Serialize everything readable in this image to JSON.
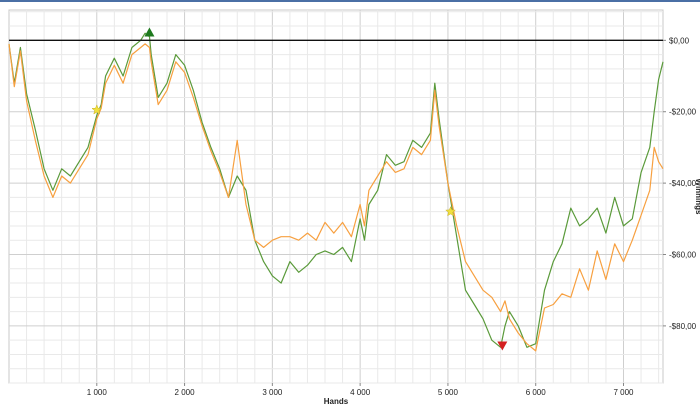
{
  "chart_data": {
    "type": "line",
    "title": "",
    "xlabel": "Hands",
    "ylabel": "Winnings",
    "xlim": [
      0,
      7450
    ],
    "ylim": [
      -96,
      8.5
    ],
    "x_ticks": [
      {
        "value": 1000,
        "label": "1 000"
      },
      {
        "value": 2000,
        "label": "2 000"
      },
      {
        "value": 3000,
        "label": "3 000"
      },
      {
        "value": 4000,
        "label": "4 000"
      },
      {
        "value": 5000,
        "label": "5 000"
      },
      {
        "value": 6000,
        "label": "6 000"
      },
      {
        "value": 7000,
        "label": "7 000"
      }
    ],
    "y_ticks": [
      {
        "value": 0,
        "label": "$0,00"
      },
      {
        "value": -20,
        "label": "-$20,00"
      },
      {
        "value": -40,
        "label": "-$40,00"
      },
      {
        "value": -60,
        "label": "-$60,00"
      },
      {
        "value": -80,
        "label": "-$80,00"
      }
    ],
    "grid": true,
    "legend": "none",
    "zero_line": 0,
    "series": [
      {
        "color": "#5a9a3a",
        "x": [
          0,
          60,
          130,
          200,
          300,
          400,
          500,
          600,
          700,
          800,
          900,
          1000,
          1050,
          1100,
          1200,
          1300,
          1400,
          1500,
          1550,
          1600,
          1620,
          1700,
          1800,
          1900,
          2000,
          2100,
          2200,
          2300,
          2400,
          2500,
          2600,
          2700,
          2800,
          2900,
          3000,
          3100,
          3200,
          3300,
          3400,
          3500,
          3600,
          3700,
          3800,
          3900,
          4000,
          4050,
          4100,
          4200,
          4300,
          4400,
          4500,
          4600,
          4700,
          4800,
          4850,
          4900,
          5000,
          5100,
          5200,
          5300,
          5400,
          5500,
          5600,
          5650,
          5700,
          5800,
          5900,
          6000,
          6100,
          6200,
          6300,
          6400,
          6500,
          6600,
          6700,
          6800,
          6900,
          7000,
          7100,
          7200,
          7300,
          7350,
          7400,
          7450
        ],
        "y": [
          -1,
          -12,
          -2,
          -15,
          -25,
          -36,
          -42,
          -36,
          -38,
          -34,
          -30,
          -21,
          -18,
          -10,
          -5,
          -10,
          -2,
          0,
          2,
          1,
          -4,
          -16,
          -12,
          -4,
          -7,
          -14,
          -23,
          -30,
          -36,
          -44,
          -38,
          -42,
          -56,
          -62,
          -66,
          -68,
          -62,
          -65,
          -63,
          -60,
          -59,
          -60,
          -58,
          -62,
          -50,
          -56,
          -46,
          -42,
          -32,
          -35,
          -34,
          -28,
          -30,
          -26,
          -12,
          -22,
          -40,
          -55,
          -70,
          -74,
          -78,
          -84,
          -86,
          -80,
          -76,
          -80,
          -86,
          -85,
          -70,
          -62,
          -57,
          -47,
          -52,
          -50,
          -47,
          -54,
          -44,
          -52,
          -50,
          -37,
          -30,
          -20,
          -11,
          -6
        ]
      },
      {
        "color": "#f7a040",
        "x": [
          0,
          60,
          130,
          200,
          300,
          400,
          500,
          600,
          700,
          800,
          900,
          1000,
          1050,
          1100,
          1200,
          1300,
          1400,
          1500,
          1550,
          1600,
          1620,
          1700,
          1800,
          1900,
          2000,
          2100,
          2200,
          2300,
          2400,
          2500,
          2600,
          2700,
          2800,
          2900,
          3000,
          3100,
          3200,
          3300,
          3400,
          3500,
          3600,
          3700,
          3800,
          3900,
          4000,
          4050,
          4100,
          4200,
          4300,
          4400,
          4500,
          4600,
          4700,
          4800,
          4850,
          4900,
          5000,
          5100,
          5200,
          5300,
          5400,
          5500,
          5600,
          5650,
          5700,
          5800,
          5900,
          6000,
          6100,
          6200,
          6300,
          6400,
          6500,
          6600,
          6700,
          6800,
          6900,
          7000,
          7100,
          7200,
          7300,
          7350,
          7400,
          7450
        ],
        "y": [
          -1,
          -13,
          -3,
          -17,
          -28,
          -38,
          -44,
          -38,
          -40,
          -36,
          -32,
          -22,
          -19,
          -12,
          -7,
          -12,
          -4,
          -2,
          -1,
          -2,
          -6,
          -18,
          -14,
          -6,
          -9,
          -16,
          -24,
          -31,
          -37,
          -44,
          -28,
          -46,
          -56,
          -58,
          -56,
          -55,
          -55,
          -56,
          -54,
          -56,
          -51,
          -54,
          -51,
          -55,
          -46,
          -52,
          -42,
          -38,
          -34,
          -37,
          -36,
          -30,
          -32,
          -28,
          -14,
          -24,
          -40,
          -52,
          -62,
          -66,
          -70,
          -72,
          -76,
          -73,
          -78,
          -82,
          -85,
          -87,
          -75,
          -74,
          -71,
          -72,
          -64,
          -70,
          -59,
          -67,
          -57,
          -62,
          -56,
          -49,
          -42,
          -30,
          -34,
          -36
        ]
      }
    ],
    "markers": [
      {
        "shape": "star",
        "color": "#f0e040",
        "x": 1000,
        "y": -19.5
      },
      {
        "shape": "triangle-up",
        "color": "#1e7a1e",
        "x": 1600,
        "y": 2.2
      },
      {
        "shape": "star",
        "color": "#f0e040",
        "x": 5030,
        "y": -48
      },
      {
        "shape": "triangle-down",
        "color": "#d42020",
        "x": 5620,
        "y": -85.5
      }
    ]
  }
}
